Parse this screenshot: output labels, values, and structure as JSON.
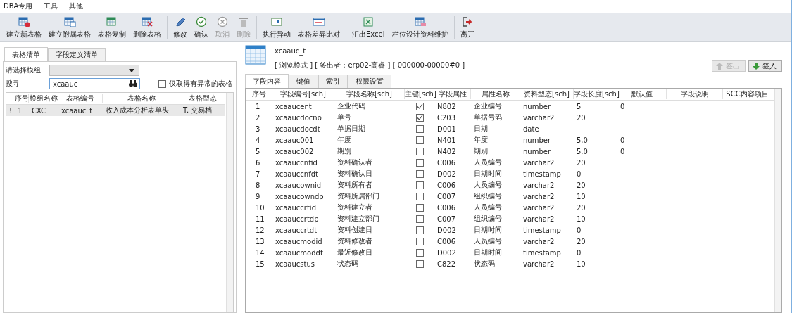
{
  "menu": [
    "DBA专用",
    "工具",
    "其他"
  ],
  "toolbar": [
    [
      {
        "label": "建立新表格",
        "kind": "add",
        "disabled": false
      },
      {
        "label": "建立附属表格",
        "kind": "attach",
        "disabled": false
      },
      {
        "label": "表格复制",
        "kind": "copy",
        "disabled": false
      },
      {
        "label": "删除表格",
        "kind": "remove",
        "disabled": false
      }
    ],
    [
      {
        "label": "修改",
        "kind": "edit",
        "disabled": false
      },
      {
        "label": "确认",
        "kind": "confirm",
        "disabled": false
      },
      {
        "label": "取消",
        "kind": "cancel",
        "disabled": true
      },
      {
        "label": "删除",
        "kind": "delete",
        "disabled": true
      }
    ],
    [
      {
        "label": "执行异动",
        "kind": "run",
        "disabled": false
      },
      {
        "label": "表格差异比对",
        "kind": "compare",
        "disabled": false
      }
    ],
    [
      {
        "label": "汇出Excel",
        "kind": "export",
        "disabled": false
      },
      {
        "label": "栏位设计资料维护",
        "kind": "design",
        "disabled": false
      }
    ],
    [
      {
        "label": "离开",
        "kind": "exit",
        "disabled": false
      }
    ]
  ],
  "left_panel": {
    "tabs": [
      {
        "label": "表格清单",
        "selected": true
      },
      {
        "label": "字段定义清单",
        "selected": false
      }
    ],
    "module_label": "请选择模组",
    "search_label": "搜寻",
    "search_value": "xcaauc",
    "abnormal_only": {
      "label": "仅取得有异常的表格",
      "checked": false
    },
    "table": {
      "columns": [
        "序号",
        "模组名称",
        "表格编号",
        "表格名称",
        "表格型态"
      ],
      "rows": [
        {
          "marker": "!",
          "cells": [
            "1",
            "CXC",
            "xcaauc_t",
            "收入成本分析表单头",
            "T. 交易档"
          ],
          "selected": true
        }
      ]
    }
  },
  "right_panel": {
    "table_name": "xcaauc_t",
    "status": "[ 浏览模式 ] [ 签出者：erp02-高睿 ] [ 000000-00000#0 ]",
    "buttons": [
      {
        "label": "签出",
        "kind": "checkout",
        "disabled": true
      },
      {
        "label": "签入",
        "kind": "checkin",
        "disabled": false
      }
    ],
    "tabs": [
      {
        "label": "字段内容",
        "selected": true
      },
      {
        "label": "键值",
        "selected": false
      },
      {
        "label": "索引",
        "selected": false
      },
      {
        "label": "权限设置",
        "selected": false
      }
    ],
    "table": {
      "columns": [
        "序号",
        "字段编号[sch]",
        "字段名称[sch]",
        "主键[sch]",
        "字段属性",
        "属性名称",
        "资料型态[sch]",
        "字段长度[sch]",
        "默认值",
        "字段说明",
        "SCC内容项目"
      ],
      "rows": [
        {
          "no": "1",
          "code": "xcaaucent",
          "name": "企业代码",
          "pk": true,
          "attr": "N802",
          "attr_name": "企业编号",
          "type": "number",
          "length": "5",
          "default": "0"
        },
        {
          "no": "2",
          "code": "xcaaucdocno",
          "name": "单号",
          "pk": true,
          "attr": "C203",
          "attr_name": "单据号码",
          "type": "varchar2",
          "length": "20"
        },
        {
          "no": "3",
          "code": "xcaaucdocdt",
          "name": "单据日期",
          "pk": false,
          "attr": "D001",
          "attr_name": "日期",
          "type": "date"
        },
        {
          "no": "4",
          "code": "xcaauc001",
          "name": "年度",
          "pk": false,
          "attr": "N401",
          "attr_name": "年度",
          "type": "number",
          "length": "5,0",
          "default": "0"
        },
        {
          "no": "5",
          "code": "xcaauc002",
          "name": "期别",
          "pk": false,
          "attr": "N402",
          "attr_name": "期别",
          "type": "number",
          "length": "5,0",
          "default": "0"
        },
        {
          "no": "6",
          "code": "xcaauccnfid",
          "name": "资料确认者",
          "pk": false,
          "attr": "C006",
          "attr_name": "人员编号",
          "type": "varchar2",
          "length": "20"
        },
        {
          "no": "7",
          "code": "xcaauccnfdt",
          "name": "资料确认日",
          "pk": false,
          "attr": "D002",
          "attr_name": "日期时间",
          "type": "timestamp",
          "length": "0"
        },
        {
          "no": "8",
          "code": "xcaaucownid",
          "name": "资料所有者",
          "pk": false,
          "attr": "C006",
          "attr_name": "人员编号",
          "type": "varchar2",
          "length": "20"
        },
        {
          "no": "9",
          "code": "xcaaucowndp",
          "name": "资料所属部门",
          "pk": false,
          "attr": "C007",
          "attr_name": "组织编号",
          "type": "varchar2",
          "length": "10"
        },
        {
          "no": "10",
          "code": "xcaauccrtid",
          "name": "资料建立者",
          "pk": false,
          "attr": "C006",
          "attr_name": "人员编号",
          "type": "varchar2",
          "length": "20"
        },
        {
          "no": "11",
          "code": "xcaauccrtdp",
          "name": "资料建立部门",
          "pk": false,
          "attr": "C007",
          "attr_name": "组织编号",
          "type": "varchar2",
          "length": "10"
        },
        {
          "no": "12",
          "code": "xcaauccrtdt",
          "name": "资料创建日",
          "pk": false,
          "attr": "D002",
          "attr_name": "日期时间",
          "type": "timestamp",
          "length": "0"
        },
        {
          "no": "13",
          "code": "xcaaucmodid",
          "name": "资料修改者",
          "pk": false,
          "attr": "C006",
          "attr_name": "人员编号",
          "type": "varchar2",
          "length": "20"
        },
        {
          "no": "14",
          "code": "xcaaucmoddt",
          "name": "最近修改日",
          "pk": false,
          "attr": "D002",
          "attr_name": "日期时间",
          "type": "timestamp",
          "length": "0"
        },
        {
          "no": "15",
          "code": "xcaaucstus",
          "name": "状态码",
          "pk": false,
          "attr": "C822",
          "attr_name": "状态码",
          "type": "varchar2",
          "length": "10"
        }
      ]
    }
  }
}
